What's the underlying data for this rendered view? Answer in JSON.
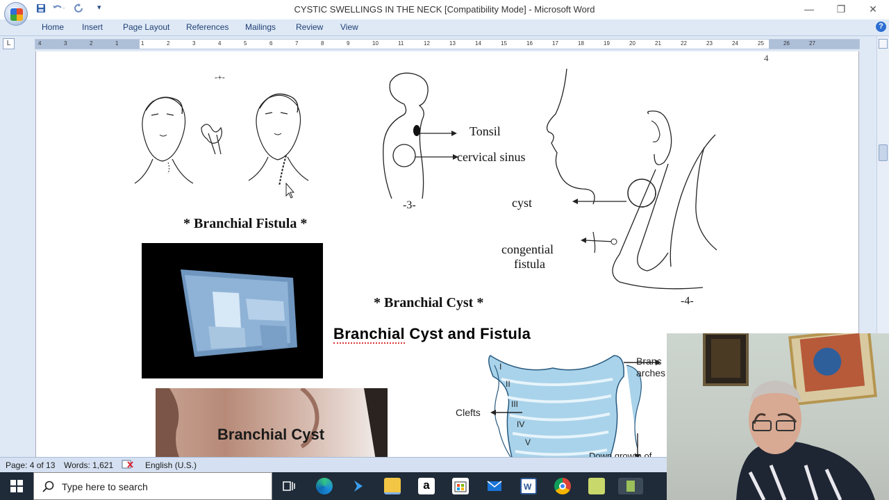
{
  "window": {
    "title": "CYSTIC SWELLINGS IN THE NECK [Compatibility Mode] - Microsoft Word",
    "controls": {
      "minimize": "—",
      "restore": "❐",
      "close": "✕"
    }
  },
  "quick_access": {
    "save": "💾",
    "undo": "↶",
    "redo": "↻",
    "customize": "▾"
  },
  "ribbon": {
    "tabs": [
      {
        "label": "Home"
      },
      {
        "label": "Insert"
      },
      {
        "label": "Page Layout"
      },
      {
        "label": "References"
      },
      {
        "label": "Mailings"
      },
      {
        "label": "Review"
      },
      {
        "label": "View"
      }
    ],
    "help": "?"
  },
  "ruler": {
    "tab_selector": "L",
    "marks": [
      "4",
      "3",
      "2",
      "1",
      "1",
      "2",
      "3",
      "4",
      "5",
      "6",
      "7",
      "8",
      "9",
      "10",
      "11",
      "12",
      "13",
      "14",
      "15",
      "16",
      "17",
      "18",
      "19",
      "20",
      "21",
      "22",
      "23",
      "24",
      "25",
      "26",
      "27"
    ]
  },
  "document": {
    "page_number": "4",
    "figure_top_left": {
      "mark": "-+-",
      "caption": "* Branchial Fistula *"
    },
    "figure_middle": {
      "tonsil_label": "Tonsil",
      "sinus_label": "cervical sinus",
      "number": "-3-"
    },
    "figure_right": {
      "cyst_label": "cyst",
      "fistula_label_1": "congential",
      "fistula_label_2": "fistula",
      "caption": "* Branchial Cyst *",
      "number": "-4-"
    },
    "heading": {
      "word1": "Branchial",
      "rest": " Cyst and Fistula"
    },
    "photo_label": "Branchial Cyst",
    "arch_diagram": {
      "arches_label_1": "Branc",
      "arches_label_2": "arches",
      "clefts_label": "Clefts",
      "down_growth_label": "Down growth of",
      "numerals": [
        "I",
        "II",
        "III",
        "IV",
        "V"
      ]
    }
  },
  "status_bar": {
    "page": "Page: 4 of 13",
    "words": "Words: 1,621",
    "language": "English (U.S.)"
  },
  "taskbar": {
    "search_placeholder": "Type here to search",
    "apps": [
      "task-view",
      "edge",
      "visual-studio",
      "file-explorer",
      "amazon",
      "store",
      "mail",
      "word",
      "chrome",
      "file-manager",
      "app"
    ]
  },
  "colors": {
    "ribbon_text": "#1e3f73",
    "title_bg": "#ffffff",
    "doc_bg": "#dfe8f5",
    "taskbar": "#1f2b38",
    "spell_underline": "#dd3333"
  }
}
